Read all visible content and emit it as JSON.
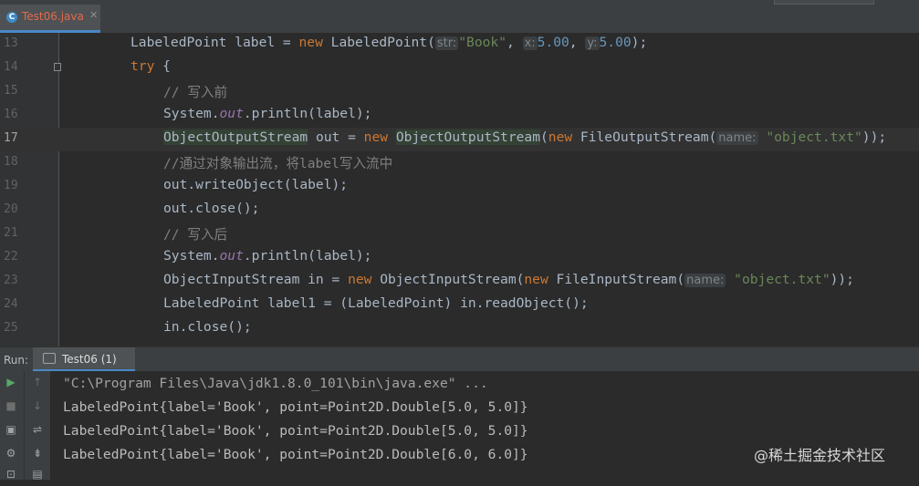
{
  "editor_tab": {
    "label": "Test06.java",
    "icon": "java-class-icon"
  },
  "code_lines": [
    {
      "num": "13",
      "current": false
    },
    {
      "num": "14",
      "current": false
    },
    {
      "num": "15",
      "current": false
    },
    {
      "num": "16",
      "current": false
    },
    {
      "num": "17",
      "current": true
    },
    {
      "num": "18",
      "current": false
    },
    {
      "num": "19",
      "current": false
    },
    {
      "num": "20",
      "current": false
    },
    {
      "num": "21",
      "current": false
    },
    {
      "num": "22",
      "current": false
    },
    {
      "num": "23",
      "current": false
    },
    {
      "num": "24",
      "current": false
    },
    {
      "num": "25",
      "current": false
    }
  ],
  "code": {
    "l13": {
      "a": "LabeledPoint label = ",
      "kw": "new",
      "b": " LabeledPoint(",
      "hint1": "str:",
      "s1": "\"Book\"",
      "c1": ", ",
      "hint2": "x:",
      "n1": "5.00",
      "c2": ", ",
      "hint3": "y:",
      "n2": "5.00",
      "end": ");"
    },
    "l14": {
      "kw": "try",
      "b": " {"
    },
    "l15": {
      "comment": "// 写入前"
    },
    "l16": {
      "a": "System.",
      "fld": "out",
      "b": ".println(label);"
    },
    "l17": {
      "cls": "ObjectOutputStream",
      "a": " out = ",
      "kw": "new",
      "b": " ",
      "cls2": "ObjectOutputStream",
      "c": "(",
      "kw2": "new",
      "d": " FileOutputStream(",
      "hint": "name:",
      "s": "\"object.txt\"",
      "end": "));"
    },
    "l18": {
      "comment": "//通过对象输出流，将label写入流中"
    },
    "l19": {
      "a": "out.writeObject(label);"
    },
    "l20": {
      "a": "out.close();"
    },
    "l21": {
      "comment": "// 写入后"
    },
    "l22": {
      "a": "System.",
      "fld": "out",
      "b": ".println(label);"
    },
    "l23": {
      "a": "ObjectInputStream in = ",
      "kw": "new",
      "b": " ObjectInputStream(",
      "kw2": "new",
      "c": " FileInputStream(",
      "hint": "name:",
      "s": "\"object.txt\"",
      "end": "));"
    },
    "l24": {
      "a": "LabeledPoint label1 = (LabeledPoint) in.readObject();"
    },
    "l25": {
      "a": "in.close();"
    }
  },
  "run_panel": {
    "label": "Run:",
    "tab_label": "Test06 (1)"
  },
  "console": {
    "command": "\"C:\\Program Files\\Java\\jdk1.8.0_101\\bin\\java.exe\" ...",
    "lines": [
      "LabeledPoint{label='Book', point=Point2D.Double[5.0, 5.0]}",
      "LabeledPoint{label='Book', point=Point2D.Double[5.0, 5.0]}",
      "LabeledPoint{label='Book', point=Point2D.Double[6.0, 6.0]}"
    ]
  },
  "toolbar": {
    "run": "▶",
    "up": "↑",
    "stop": "■",
    "down": "↓",
    "camera": "▣",
    "wrap": "⇌",
    "settings": "⚙",
    "sort": "⇟",
    "print": "▤",
    "pin": "⊡"
  },
  "watermark": "@稀土掘金技术社区",
  "colors": {
    "keyword": "#cc7832",
    "string": "#6a8759",
    "number": "#6897bb",
    "comment": "#808080",
    "accent": "#4a88c7"
  }
}
